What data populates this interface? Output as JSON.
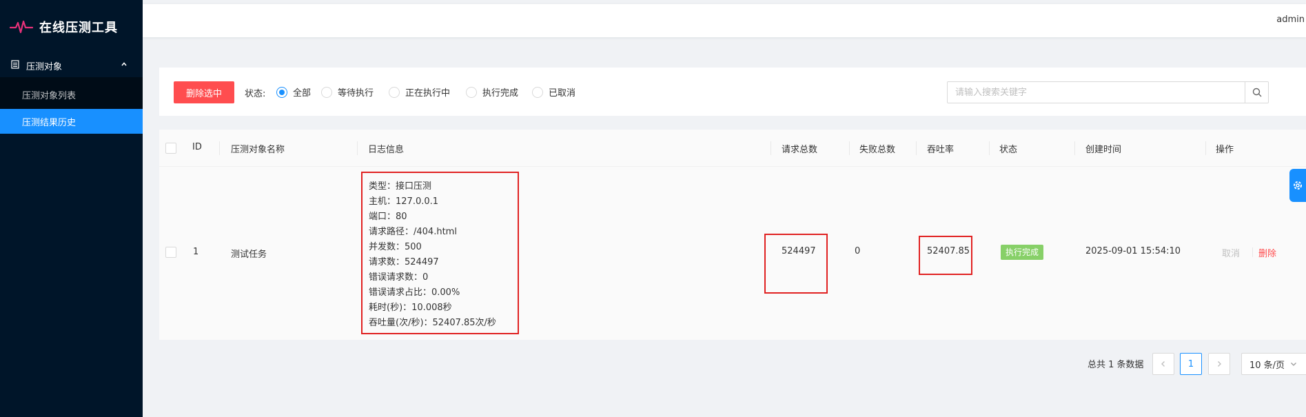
{
  "app": {
    "title": "在线压测工具"
  },
  "sidebar": {
    "group_label": "压测对象",
    "items": [
      {
        "label": "压测对象列表",
        "active": false
      },
      {
        "label": "压测结果历史",
        "active": true
      }
    ]
  },
  "header": {
    "username": "admin"
  },
  "filter": {
    "delete_selected_label": "删除选中",
    "status_label": "状态:",
    "options": [
      "全部",
      "等待执行",
      "正在执行中",
      "执行完成",
      "已取消"
    ],
    "selected": "全部",
    "search_placeholder": "请输入搜索关键字"
  },
  "table": {
    "columns": [
      "ID",
      "压测对象名称",
      "日志信息",
      "请求总数",
      "失败总数",
      "吞吐率",
      "状态",
      "创建时间",
      "操作"
    ],
    "rows": [
      {
        "id": "1",
        "name": "测试任务",
        "log": [
          "类型：接口压测",
          "主机：127.0.0.1",
          "端口：80",
          "请求路径：/404.html",
          "并发数：500",
          "请求数：524497",
          "错误请求数：0",
          "错误请求占比：0.00%",
          "耗时(秒)：10.008秒",
          "吞吐量(次/秒)：52407.85次/秒"
        ],
        "total_requests": "524497",
        "failed_total": "0",
        "throughput": "52407.85",
        "status": "执行完成",
        "created_at": "2025-09-01 15:54:10",
        "actions": {
          "cancel": "取消",
          "delete": "删除"
        }
      }
    ]
  },
  "pagination": {
    "total_text": "总共 1 条数据",
    "current_page": "1",
    "page_size": "10 条/页"
  },
  "colors": {
    "primary": "#1890ff",
    "danger": "#ff4d4f",
    "success_tag": "#87d068",
    "sidebar_bg": "#001529",
    "highlight_border": "#e02020"
  }
}
